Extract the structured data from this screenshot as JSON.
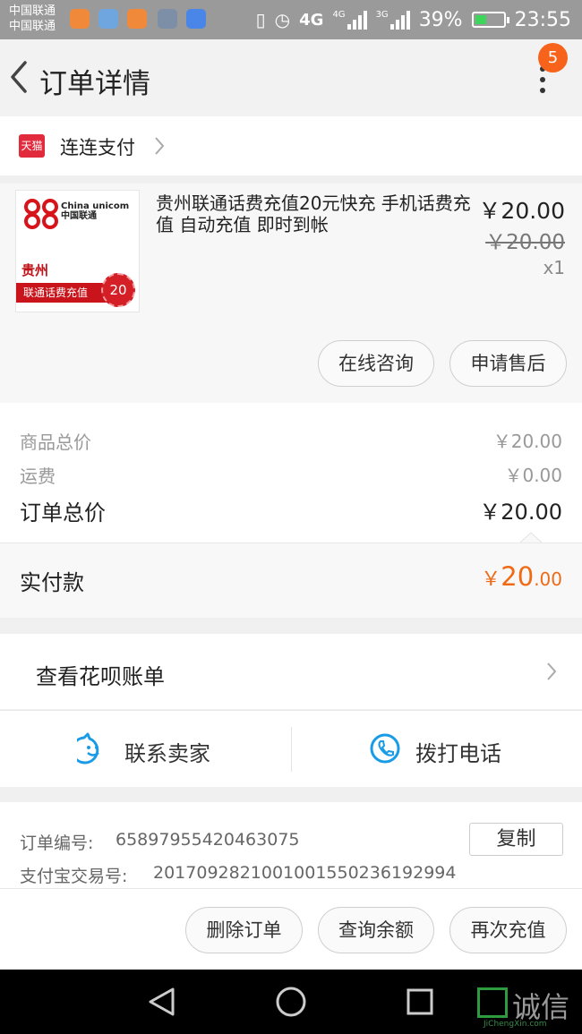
{
  "status_bar": {
    "carrier_1": "中国联通",
    "carrier_2": "中国联通",
    "network_1": "4G",
    "network_2": "4G",
    "network_3": "3G",
    "battery": "39%",
    "time": "23:55"
  },
  "header": {
    "title": "订单详情",
    "notification_count": "5"
  },
  "shop": {
    "badge": "天猫",
    "name": "连连支付"
  },
  "product": {
    "thumb_brand": "China unicom 中国联通",
    "thumb_region": "贵州",
    "thumb_banner": "联通话费充值",
    "thumb_amount": "20",
    "name": "贵州联通话费充值20元快充 手机话费充值 自动充值 即时到帐",
    "price": "￥20.00",
    "original_price": "￥20.00",
    "quantity": "x1",
    "consult_label": "在线咨询",
    "aftersale_label": "申请售后"
  },
  "summary": {
    "goods_total_label": "商品总价",
    "goods_total_value": "￥20.00",
    "shipping_label": "运费",
    "shipping_value": "￥0.00",
    "order_total_label": "订单总价",
    "order_total_value": "￥20.00",
    "paid_label": "实付款",
    "paid_currency": "￥",
    "paid_integer": "20",
    "paid_decimal": ".00"
  },
  "huabei": {
    "label": "查看花呗账单"
  },
  "contact": {
    "seller_label": "联系卖家",
    "phone_label": "拨打电话"
  },
  "order_info": {
    "order_no_label": "订单编号:",
    "order_no_value": "65897955420463075",
    "alipay_no_label": "支付宝交易号:",
    "alipay_no_value": "2017092821001001550236192994",
    "copy_label": "复制"
  },
  "actions": {
    "delete_label": "删除订单",
    "balance_label": "查询余额",
    "recharge_label": "再次充值"
  },
  "watermark": {
    "text": "诚信",
    "sub": "JiChengXin.com"
  },
  "colors": {
    "accent_orange": "#f7631b",
    "paid_orange": "#f06a16",
    "tmall_red": "#e22a3d",
    "contact_blue": "#1a9be6"
  }
}
